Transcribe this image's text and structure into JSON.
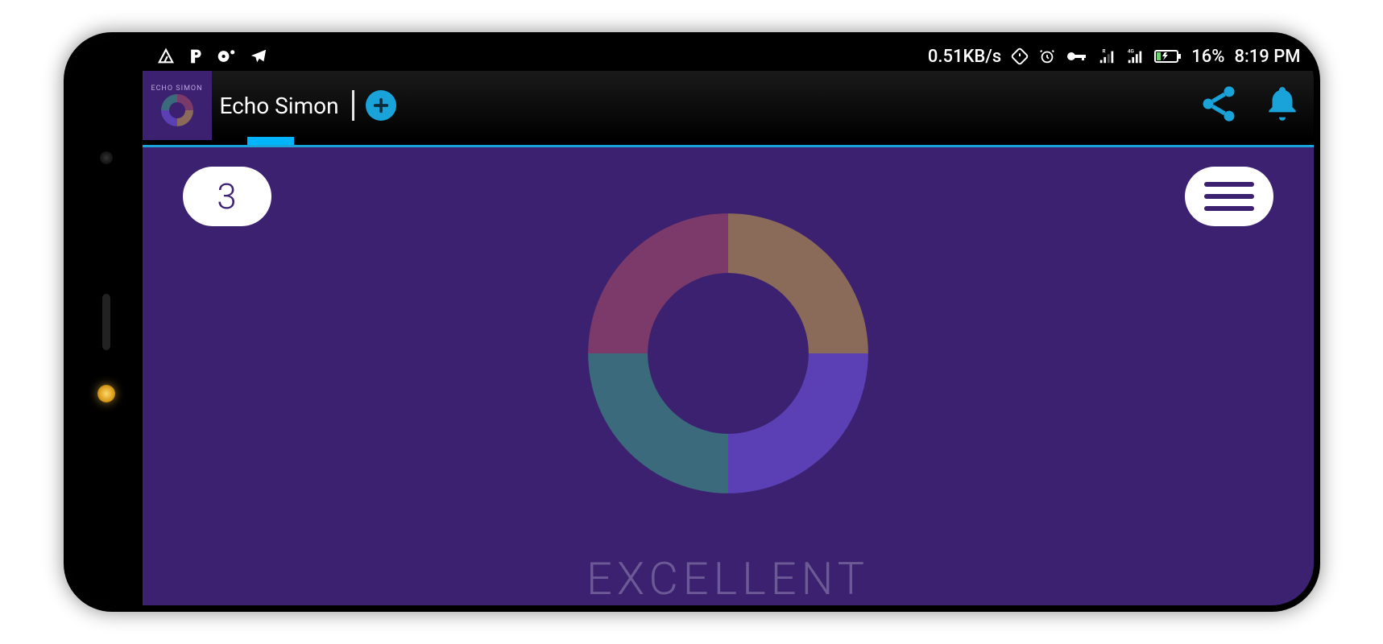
{
  "status": {
    "data_rate": "0.51KB/s",
    "battery_pct": "16%",
    "time": "8:19 PM"
  },
  "header": {
    "app_name": "Echo Simon",
    "icon_label": "ECHO SIMON"
  },
  "game": {
    "score": "3",
    "feedback": "EXCELLENT",
    "ring_colors": {
      "tl": "#7b3a6a",
      "tr": "#8a6a58",
      "br": "#5a3fb5",
      "bl": "#3a6a7b"
    }
  }
}
